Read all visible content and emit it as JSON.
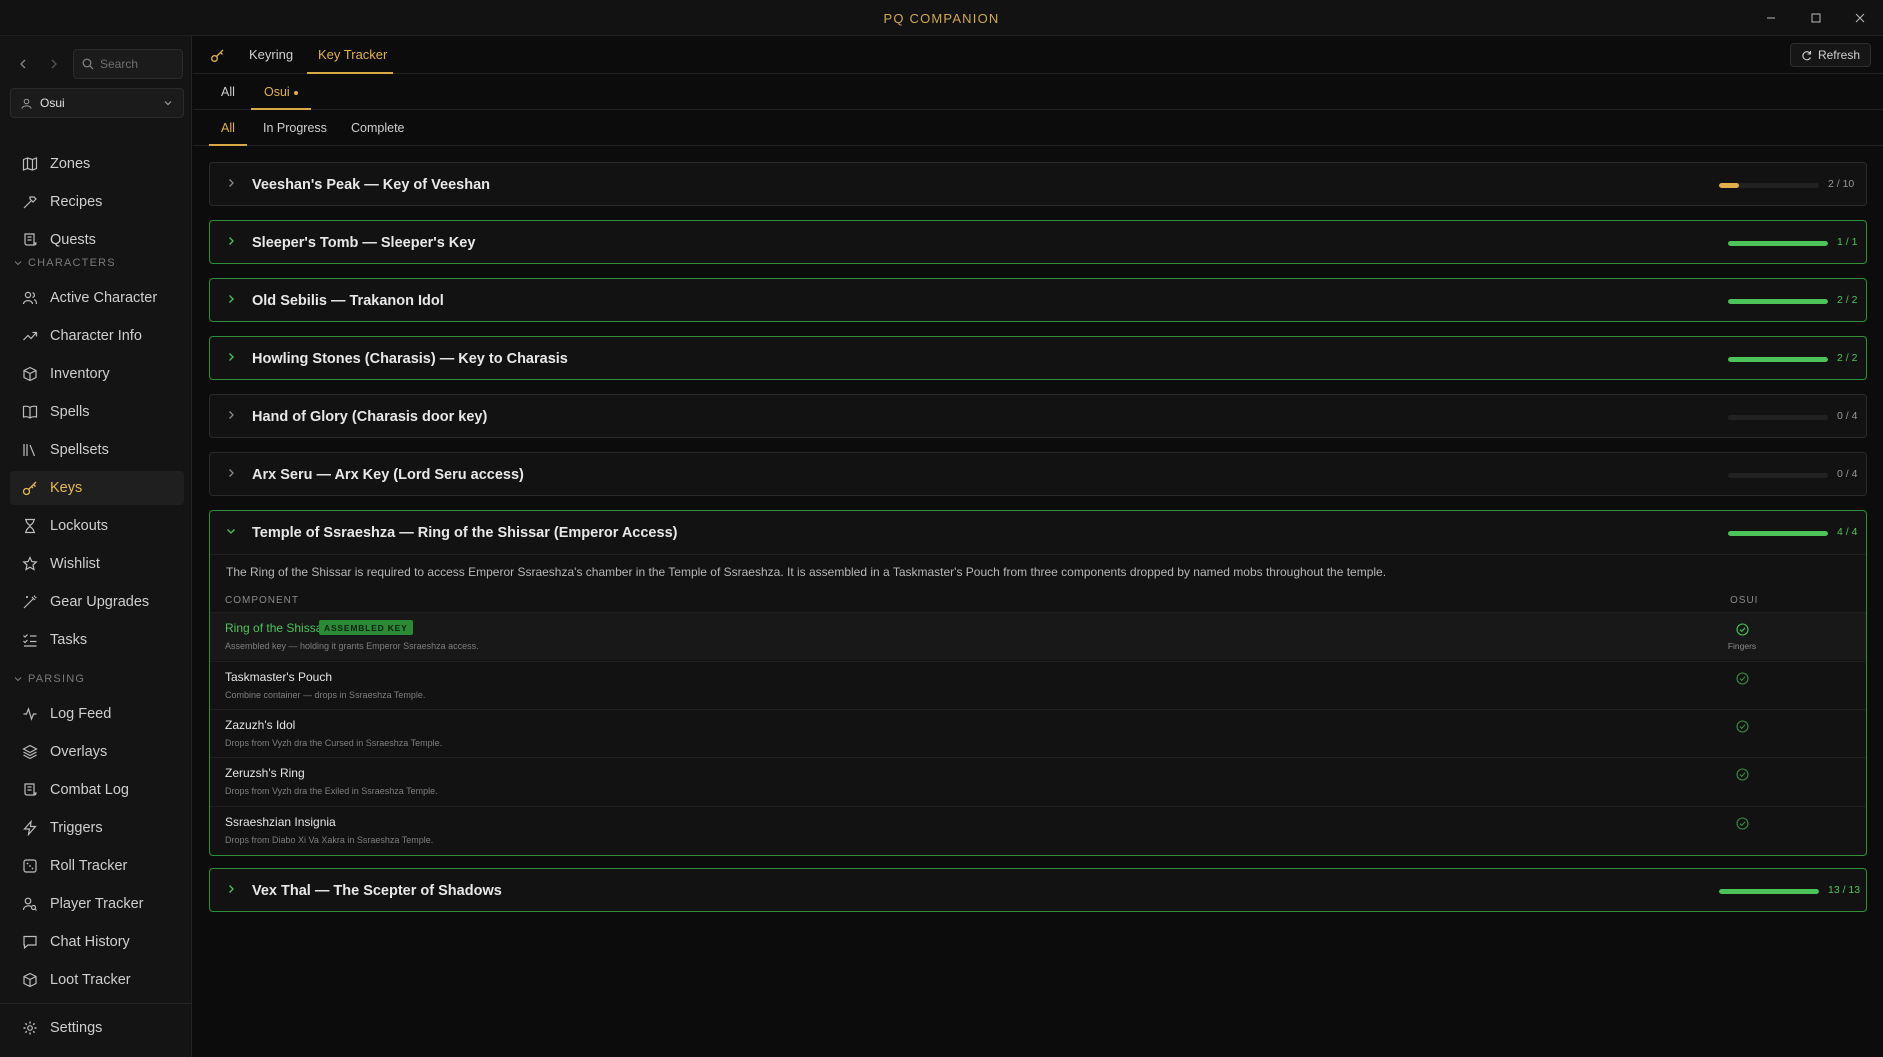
{
  "window": {
    "title": "PQ COMPANION"
  },
  "sidebar": {
    "search_placeholder": "Search",
    "character": "Osui",
    "top_items": [
      {
        "label": "Zones",
        "icon": "map-icon"
      },
      {
        "label": "Recipes",
        "icon": "hammer-icon"
      },
      {
        "label": "Quests",
        "icon": "scroll-icon"
      }
    ],
    "sections": [
      {
        "label": "CHARACTERS",
        "items": [
          {
            "label": "Active Character",
            "icon": "users-icon"
          },
          {
            "label": "Character Info",
            "icon": "trending-icon"
          },
          {
            "label": "Inventory",
            "icon": "package-icon"
          },
          {
            "label": "Spells",
            "icon": "book-icon"
          },
          {
            "label": "Spellsets",
            "icon": "library-icon"
          },
          {
            "label": "Keys",
            "icon": "key-icon",
            "active": true
          },
          {
            "label": "Lockouts",
            "icon": "hourglass-icon"
          },
          {
            "label": "Wishlist",
            "icon": "star-icon"
          },
          {
            "label": "Gear Upgrades",
            "icon": "wand-icon"
          },
          {
            "label": "Tasks",
            "icon": "list-checks-icon"
          }
        ]
      },
      {
        "label": "PARSING",
        "items": [
          {
            "label": "Log Feed",
            "icon": "activity-icon"
          },
          {
            "label": "Overlays",
            "icon": "layers-icon"
          },
          {
            "label": "Combat Log",
            "icon": "scroll-icon"
          },
          {
            "label": "Triggers",
            "icon": "zap-icon"
          },
          {
            "label": "Roll Tracker",
            "icon": "dice-icon"
          },
          {
            "label": "Player Tracker",
            "icon": "user-search-icon"
          },
          {
            "label": "Chat History",
            "icon": "message-icon"
          },
          {
            "label": "Loot Tracker",
            "icon": "package-icon"
          }
        ]
      }
    ],
    "settings": "Settings"
  },
  "tabs": {
    "keyring": "Keyring",
    "key_tracker": "Key Tracker",
    "refresh": "Refresh"
  },
  "char_tabs": {
    "all": "All",
    "osui": "Osui"
  },
  "filter_tabs": {
    "all": "All",
    "in_progress": "In Progress",
    "complete": "Complete"
  },
  "keys": [
    {
      "title": "Veeshan's Peak — Key of Veeshan",
      "count": "2 / 10",
      "progress": 0.2,
      "complete": false
    },
    {
      "title": "Sleeper's Tomb — Sleeper's Key",
      "count": "1 / 1",
      "progress": 1,
      "complete": true
    },
    {
      "title": "Old Sebilis — Trakanon Idol",
      "count": "2 / 2",
      "progress": 1,
      "complete": true
    },
    {
      "title": "Howling Stones (Charasis) — Key to Charasis",
      "count": "2 / 2",
      "progress": 1,
      "complete": true
    },
    {
      "title": "Hand of Glory (Charasis door key)",
      "count": "0 / 4",
      "progress": 0,
      "complete": false
    },
    {
      "title": "Arx Seru — Arx Key (Lord Seru access)",
      "count": "0 / 4",
      "progress": 0,
      "complete": false
    },
    {
      "title": "Temple of Ssraeshza — Ring of the Shissar (Emperor Access)",
      "count": "4 / 4",
      "progress": 1,
      "complete": true,
      "expanded": true
    },
    {
      "title": "Vex Thal — The Scepter of Shadows",
      "count": "13 / 13",
      "progress": 1,
      "complete": true
    }
  ],
  "expanded": {
    "description": "The Ring of the Shissar is required to access Emperor Ssraeshza's chamber in the Temple of Ssraeshza. It is assembled in a Taskmaster's Pouch from three components dropped by named mobs throughout the temple.",
    "col_component": "COMPONENT",
    "col_character": "OSUI",
    "components": [
      {
        "name": "Ring of the Shissar",
        "badge": "ASSEMBLED KEY",
        "sub": "Assembled key — holding it grants Emperor Ssraeshza access.",
        "location": "Fingers",
        "highlight": true
      },
      {
        "name": "Taskmaster's Pouch",
        "sub": "Combine container — drops in Ssraeshza Temple."
      },
      {
        "name": "Zazuzh's Idol",
        "sub": "Drops from Vyzh dra the Cursed in Ssraeshza Temple."
      },
      {
        "name": "Zeruzsh's Ring",
        "sub": "Drops from Vyzh dra the Exiled in Ssraeshza Temple."
      },
      {
        "name": "Ssraeshzian Insignia",
        "sub": "Drops from Diabo Xi Va Xakra in Ssraeshza Temple."
      }
    ]
  },
  "colors": {
    "accent": "#e0b04a",
    "complete": "#4cc45a",
    "border_complete": "#2f8f3a"
  }
}
